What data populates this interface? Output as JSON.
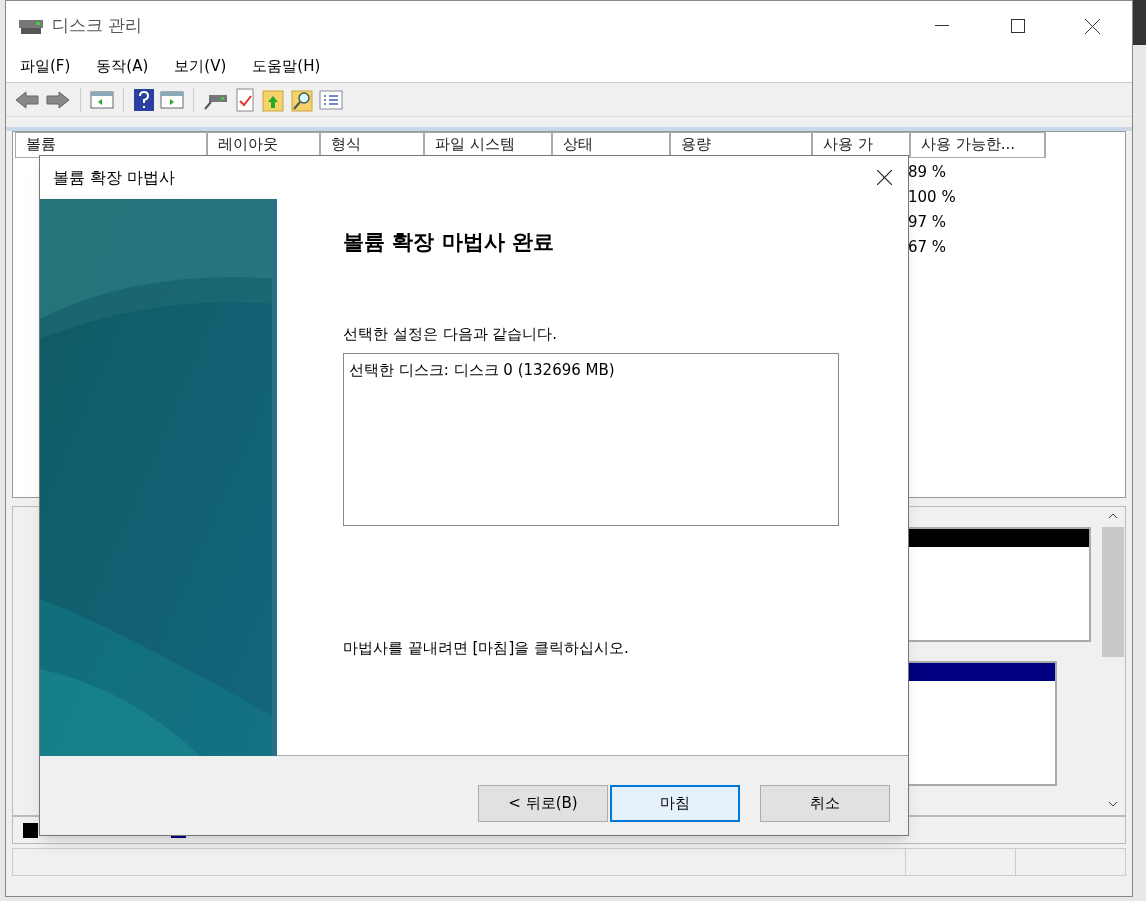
{
  "window": {
    "title": "디스크 관리"
  },
  "menu": [
    {
      "label": "파일(F)"
    },
    {
      "label": "동작(A)"
    },
    {
      "label": "보기(V)"
    },
    {
      "label": "도움말(H)"
    }
  ],
  "volume_table": {
    "columns": [
      "볼륨",
      "레이아웃",
      "형식",
      "파일 시스템",
      "상태",
      "용량",
      "사용 가",
      "사용 가능한..."
    ],
    "rows": [
      {
        "free_percent": "89 %"
      },
      {
        "free_percent": "100 %"
      },
      {
        "free_percent": "97 %"
      },
      {
        "free_percent": "67 %"
      }
    ]
  },
  "disk_partitions": [
    {
      "color": "#000000"
    },
    {
      "color": "#000080"
    }
  ],
  "legend": [
    {
      "color": "#000000"
    },
    {
      "color": "#000080"
    }
  ],
  "dialog": {
    "title": "볼륨 확장 마법사",
    "heading": "볼륨 확장 마법사 완료",
    "intro": "선택한 설정은 다음과 같습니다.",
    "summary": [
      "선택한 디스크: 디스크 0 (132696 MB)"
    ],
    "finish_hint": "마법사를 끝내려면 [마침]을 클릭하십시오.",
    "buttons": [
      {
        "label": "< 뒤로(B)",
        "focused": false
      },
      {
        "label": "마침",
        "focused": true
      },
      {
        "label": "취소",
        "focused": false
      }
    ]
  }
}
